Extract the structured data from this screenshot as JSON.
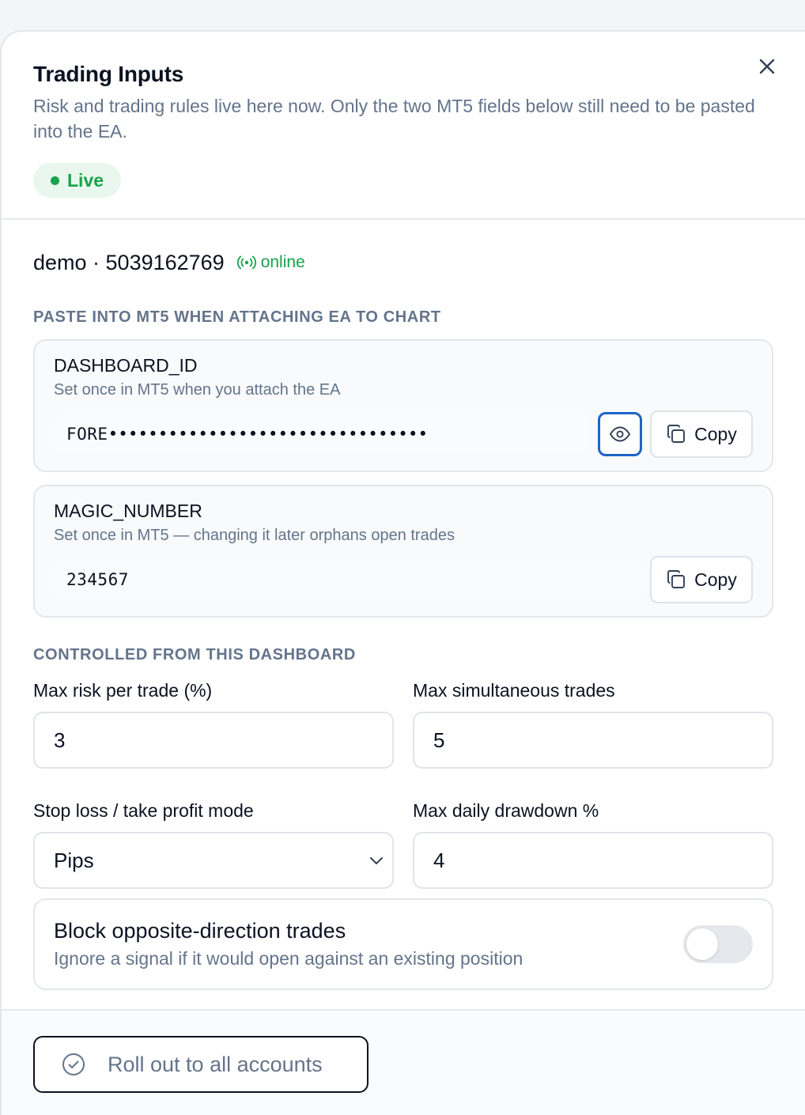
{
  "header": {
    "title": "Trading Inputs",
    "subtitle": "Risk and trading rules live here now. Only the two MT5 fields below still need to be pasted into the EA.",
    "status_badge": "Live"
  },
  "account": {
    "label": "demo · 5039162769",
    "connection_status": "online"
  },
  "mt5_section": {
    "label": "PASTE INTO MT5 WHEN ATTACHING EA TO CHART",
    "fields": [
      {
        "name": "DASHBOARD_ID",
        "hint": "Set once in MT5 when you attach the EA",
        "value_prefix": "FORE",
        "value_masked": "••••••••••••••••••••••••••••••••",
        "copy_label": "Copy"
      },
      {
        "name": "MAGIC_NUMBER",
        "hint": "Set once in MT5 — changing it later orphans open trades",
        "value": "234567",
        "copy_label": "Copy"
      }
    ]
  },
  "dashboard_section": {
    "label": "CONTROLLED FROM THIS DASHBOARD",
    "inputs": [
      {
        "label": "Max risk per trade (%)",
        "value": "3"
      },
      {
        "label": "Max simultaneous trades",
        "value": "5"
      },
      {
        "label": "Stop loss / take profit mode",
        "value": "Pips"
      },
      {
        "label": "Max daily drawdown %",
        "value": "4"
      }
    ],
    "toggle": {
      "title": "Block opposite-direction trades",
      "description": "Ignore a signal if it would open against an existing position",
      "enabled": false
    }
  },
  "footer": {
    "rollout_label": "Roll out to all accounts"
  },
  "colors": {
    "accent_green": "#16a34a",
    "focus_blue": "#1d64c8",
    "muted_text": "#64748b"
  }
}
